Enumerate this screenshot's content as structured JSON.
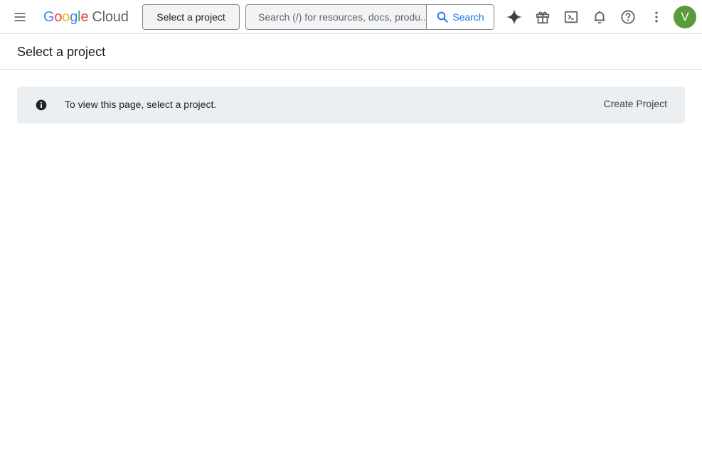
{
  "topbar": {
    "logo": {
      "google": "Google",
      "cloud": "Cloud"
    },
    "project_selector_label": "Select a project",
    "search": {
      "placeholder": "Search (/) for resources, docs, produ...",
      "button_label": "Search"
    },
    "icons": [
      "menu-icon",
      "gemini-sparkle-icon",
      "gift-icon",
      "cloud-shell-icon",
      "notifications-bell-icon",
      "help-icon",
      "more-vert-icon"
    ],
    "avatar_initial": "V",
    "avatar_color": "#5b9a3a"
  },
  "page": {
    "title": "Select a project",
    "banner": {
      "message": "To view this page, select a project.",
      "action_label": "Create Project"
    }
  },
  "colors": {
    "accent": "#1a73e8",
    "banner_bg": "#eceff1",
    "google_blue": "#4285f4",
    "google_red": "#ea4335",
    "google_yellow": "#fbbc05",
    "google_green": "#34a853"
  }
}
